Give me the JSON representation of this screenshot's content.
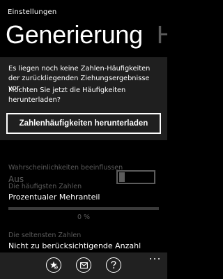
{
  "app": {
    "title": "Einstellungen"
  },
  "pivot": {
    "current": "Generierung",
    "next": "H"
  },
  "dialog": {
    "message": "Es liegen noch keine Zahlen-Häufigkeiten der zurückliegenden Ziehungsergebnisse vor.",
    "question": "Möchten Sie jetzt die Häufigkeiten herunterladen?",
    "button_label": "Zahlenhäufigkeiten herunterladen"
  },
  "settings": {
    "probability": {
      "label": "Wahrscheinlichkeiten beeinflussen",
      "value": "Aus",
      "toggle_on": false
    },
    "frequent": {
      "label": "Die häufigsten Zahlen",
      "value": "Prozentualer Mehranteil",
      "progress_fraction": 0,
      "progress_text": "0 %"
    },
    "rare": {
      "label": "Die seltensten Zahlen",
      "value": "Nicht zu berücksichtigende Anzahl"
    }
  },
  "app_bar": {
    "buttons": [
      {
        "icon": "star-badge-icon"
      },
      {
        "icon": "mail-icon"
      },
      {
        "icon": "help-icon"
      }
    ],
    "more_icon": "ellipsis-icon"
  }
}
